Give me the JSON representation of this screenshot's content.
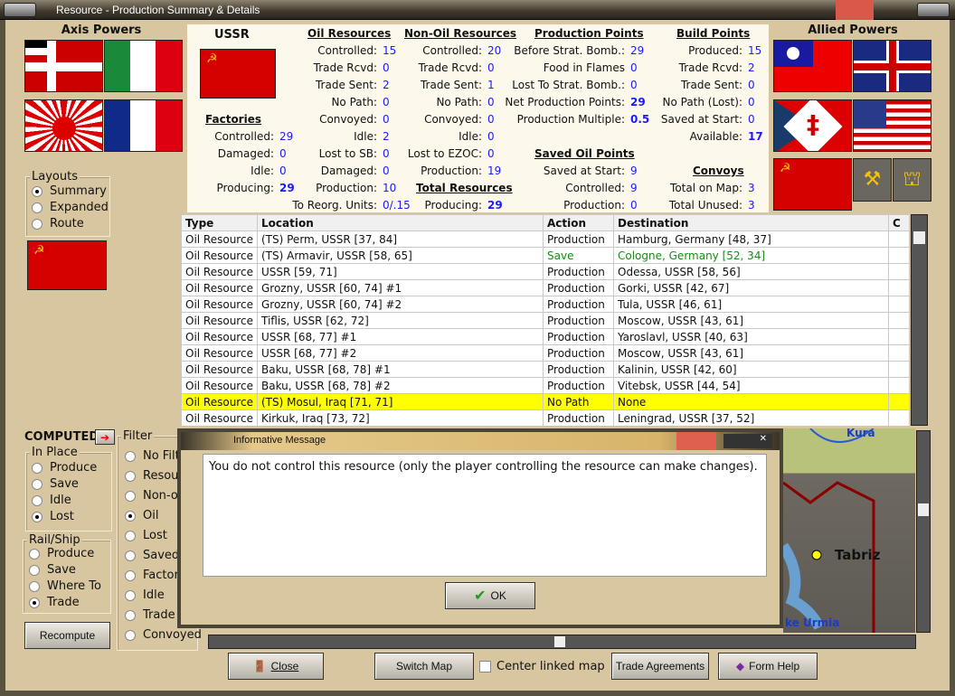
{
  "window": {
    "title": "Resource - Production Summary & Details"
  },
  "axis": {
    "title": "Axis Powers"
  },
  "allied": {
    "title": "Allied Powers"
  },
  "layouts": {
    "title": "Layouts",
    "options": [
      {
        "label": "Summary",
        "checked": true
      },
      {
        "label": "Expanded",
        "checked": false
      },
      {
        "label": "Route",
        "checked": false
      }
    ]
  },
  "country": {
    "name": "USSR"
  },
  "factories": {
    "title": "Factories",
    "rows": [
      {
        "label": "Controlled:",
        "value": "29"
      },
      {
        "label": "Damaged:",
        "value": "0"
      },
      {
        "label": "Idle:",
        "value": "0"
      },
      {
        "label": "Producing:",
        "value": "29",
        "bold": true
      }
    ]
  },
  "oil": {
    "title": "Oil Resources",
    "rows": [
      {
        "label": "Controlled:",
        "value": "15"
      },
      {
        "label": "Trade Rcvd:",
        "value": "0"
      },
      {
        "label": "Trade Sent:",
        "value": "2"
      },
      {
        "label": "No Path:",
        "value": "0"
      },
      {
        "label": "Convoyed:",
        "value": "0"
      },
      {
        "label": "Idle:",
        "value": "2"
      },
      {
        "label": "Lost to SB:",
        "value": "0"
      },
      {
        "label": "Damaged:",
        "value": "0"
      },
      {
        "label": "Production:",
        "value": "10"
      },
      {
        "label": "To Reorg. Units:",
        "value": "0/.15"
      }
    ]
  },
  "nonoil": {
    "title": "Non-Oil Resources",
    "rows": [
      {
        "label": "Controlled:",
        "value": "20"
      },
      {
        "label": "Trade Rcvd:",
        "value": "0"
      },
      {
        "label": "Trade Sent:",
        "value": "1"
      },
      {
        "label": "No Path:",
        "value": "0"
      },
      {
        "label": "Convoyed:",
        "value": "0"
      },
      {
        "label": "Idle:",
        "value": "0"
      },
      {
        "label": "Lost to EZOC:",
        "value": "0"
      },
      {
        "label": "Production:",
        "value": "19"
      }
    ]
  },
  "total": {
    "title": "Total Resources",
    "label": "Producing:",
    "value": "29"
  },
  "production": {
    "title": "Production Points",
    "rows": [
      {
        "label": "Before Strat. Bomb.:",
        "value": "29"
      },
      {
        "label": "Food in Flames",
        "value": "0"
      },
      {
        "label": "Lost To Strat. Bomb.:",
        "value": "0"
      },
      {
        "label": "Net Production Points:",
        "value": "29",
        "bold": true
      },
      {
        "label": "Production Multiple:",
        "value": "0.5",
        "bold": true
      }
    ]
  },
  "savedoil": {
    "title": "Saved Oil Points",
    "rows": [
      {
        "label": "Saved at Start:",
        "value": "9"
      },
      {
        "label": "Controlled:",
        "value": "9"
      },
      {
        "label": "Production:",
        "value": "0"
      }
    ]
  },
  "build": {
    "title": "Build Points",
    "rows": [
      {
        "label": "Produced:",
        "value": "15"
      },
      {
        "label": "Trade Rcvd:",
        "value": "2"
      },
      {
        "label": "Trade Sent:",
        "value": "0"
      },
      {
        "label": "No Path (Lost):",
        "value": "0"
      },
      {
        "label": "Saved at Start:",
        "value": "0"
      },
      {
        "label": "Available:",
        "value": "17",
        "bold": true
      }
    ]
  },
  "convoys": {
    "title": "Convoys",
    "rows": [
      {
        "label": "Total on Map:",
        "value": "3"
      },
      {
        "label": "Total Unused:",
        "value": "3"
      }
    ]
  },
  "table": {
    "headers": [
      "Type",
      "Location",
      "Action",
      "Destination",
      "C"
    ],
    "rows": [
      [
        "Oil Resource",
        "(TS) Perm, USSR [37, 84]",
        "Production",
        "Hamburg, Germany [48, 37]"
      ],
      [
        "Oil Resource",
        "(TS) Armavir, USSR [58, 65]",
        "Save",
        "Cologne, Germany [52, 34]"
      ],
      [
        "Oil Resource",
        "USSR [59, 71]",
        "Production",
        "Odessa, USSR [58, 56]"
      ],
      [
        "Oil Resource",
        "Grozny, USSR [60, 74] #1",
        "Production",
        "Gorki, USSR [42, 67]"
      ],
      [
        "Oil Resource",
        "Grozny, USSR [60, 74] #2",
        "Production",
        "Tula, USSR [46, 61]"
      ],
      [
        "Oil Resource",
        "Tiflis, USSR [62, 72]",
        "Production",
        "Moscow, USSR [43, 61]"
      ],
      [
        "Oil Resource",
        "USSR [68, 77] #1",
        "Production",
        "Yaroslavl, USSR [40, 63]"
      ],
      [
        "Oil Resource",
        "USSR [68, 77] #2",
        "Production",
        "Moscow, USSR [43, 61]"
      ],
      [
        "Oil Resource",
        "Baku, USSR [68, 78] #1",
        "Production",
        "Kalinin, USSR [42, 60]"
      ],
      [
        "Oil Resource",
        "Baku, USSR [68, 78] #2",
        "Production",
        "Vitebsk, USSR [44, 54]"
      ],
      [
        "Oil Resource",
        "(TS) Mosul, Iraq [71, 71]",
        "No Path",
        "None"
      ],
      [
        "Oil Resource",
        "Kirkuk, Iraq [73, 72]",
        "Production",
        "Leningrad, USSR [37, 52]"
      ]
    ],
    "selected_row": 10
  },
  "computed": {
    "label": "COMPUTED"
  },
  "inplace": {
    "title": "In Place",
    "options": [
      {
        "label": "Produce",
        "checked": false
      },
      {
        "label": "Save",
        "checked": false
      },
      {
        "label": "Idle",
        "checked": false
      },
      {
        "label": "Lost",
        "checked": true
      }
    ]
  },
  "railship": {
    "title": "Rail/Ship",
    "options": [
      {
        "label": "Produce",
        "checked": false
      },
      {
        "label": "Save",
        "checked": false
      },
      {
        "label": "Where To",
        "checked": false
      },
      {
        "label": "Trade",
        "checked": true
      }
    ]
  },
  "filter": {
    "title": "Filter",
    "options": [
      {
        "label": "No Filt",
        "checked": false
      },
      {
        "label": "Resour",
        "checked": false
      },
      {
        "label": "Non-o",
        "checked": false
      },
      {
        "label": "Oil",
        "checked": true
      },
      {
        "label": "Lost",
        "checked": false
      },
      {
        "label": "Saved",
        "checked": false
      },
      {
        "label": "Factor",
        "checked": false
      },
      {
        "label": "Idle",
        "checked": false
      },
      {
        "label": "Trade",
        "checked": false
      },
      {
        "label": "Convoyed",
        "checked": false
      }
    ]
  },
  "recompute": "Recompute",
  "dialog": {
    "title": "Informative Message",
    "message": "You do not control this resource (only the player controlling the resource can make changes).",
    "ok": "OK"
  },
  "map": {
    "labels": [
      "Kura",
      "Tabriz",
      "ke Urmia"
    ]
  },
  "buttons": {
    "close": "Close",
    "switch_map": "Switch Map",
    "center_linked": "Center linked map",
    "trade": "Trade Agreements",
    "help": "Form Help"
  }
}
